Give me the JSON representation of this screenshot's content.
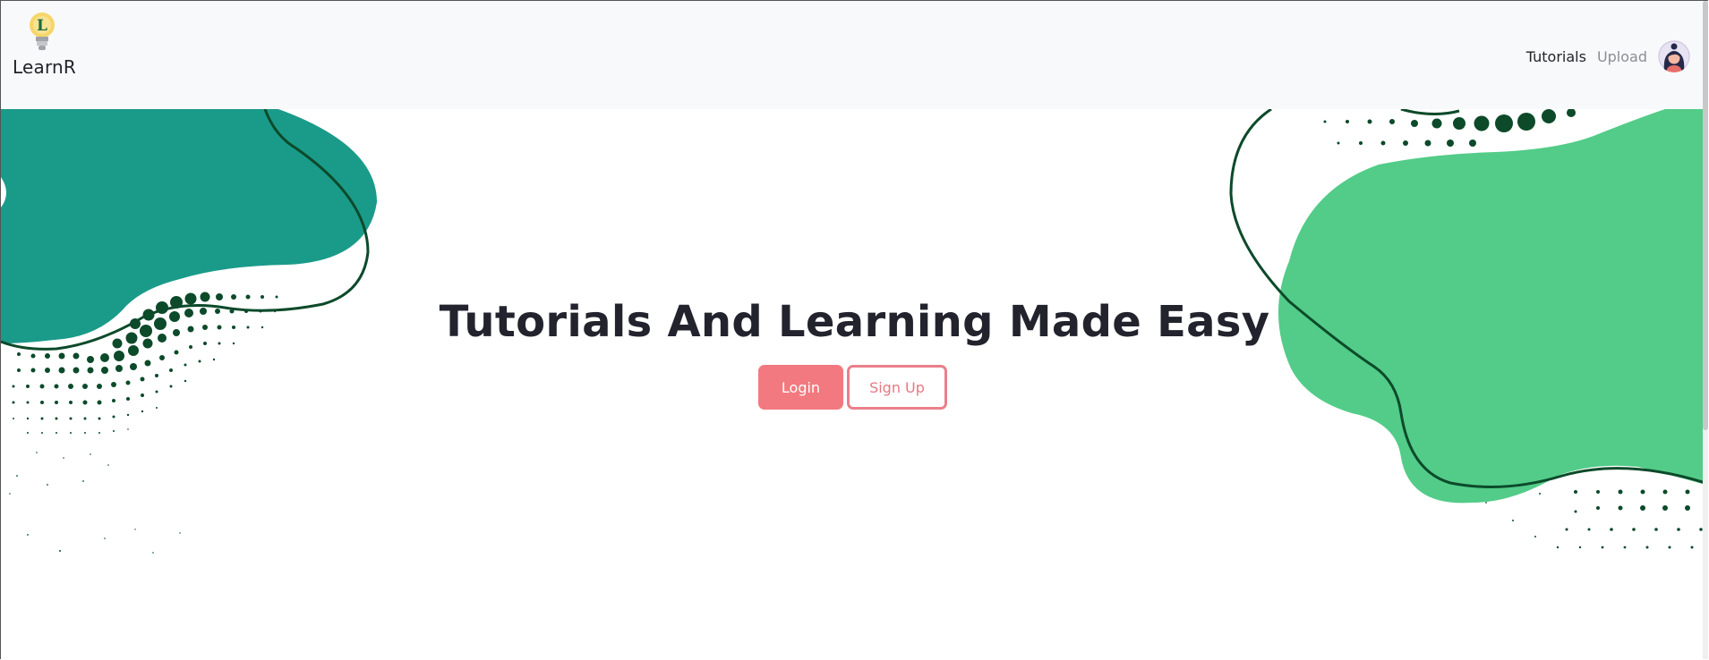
{
  "brand": {
    "name": "LearnR",
    "logo_letter": "L"
  },
  "nav": {
    "items": [
      {
        "label": "Tutorials"
      },
      {
        "label": "Upload"
      }
    ]
  },
  "hero": {
    "title": "Tutorials And Learning Made Easy",
    "login_label": "Login",
    "signup_label": "Sign Up"
  },
  "colors": {
    "navbar_bg": "#f8f9fa",
    "teal_blob": "#1a9b8a",
    "green_blob": "#52cc88",
    "dark_green": "#0c4a2a",
    "primary": "#f2797f"
  }
}
